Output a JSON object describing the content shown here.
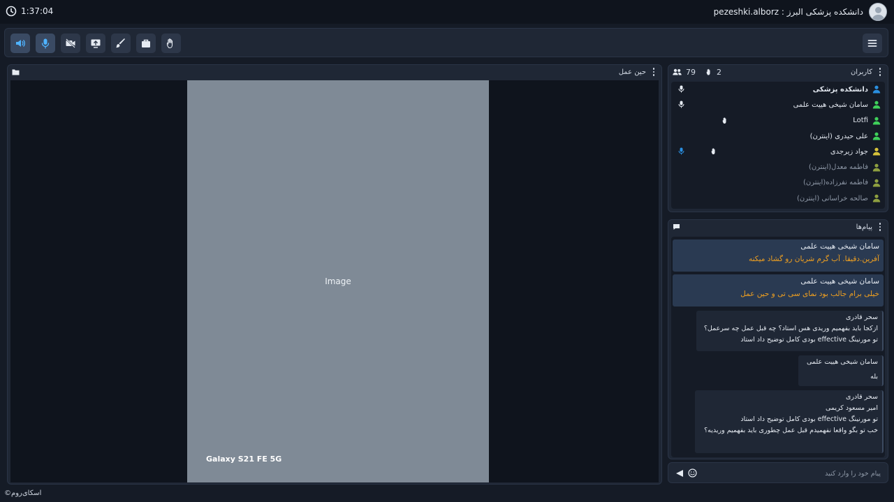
{
  "session": {
    "timer": "1:37:04"
  },
  "user": {
    "display": "pezeshki.alborz : دانشکده پزشکی البرز"
  },
  "video_panel": {
    "title": "حین عمل"
  },
  "media": {
    "watermark": "Galaxy S21 FE 5G"
  },
  "users_panel": {
    "title": "کاربران",
    "raised_hands": "2",
    "participant_count": "79",
    "items": [
      {
        "name": "دانشکده پزشکی"
      },
      {
        "name": "سامان شیخی هییت علمی"
      },
      {
        "name": "Lotfi"
      },
      {
        "name": "علی حیدری (اینترن)"
      },
      {
        "name": "جواد زیرجدی"
      },
      {
        "name": "فاطمه معدل(اینترن)"
      },
      {
        "name": "فاطمه نفرزاده(اینترن)"
      },
      {
        "name": "صالحه خراسانی (اینترن)"
      }
    ]
  },
  "messages_panel": {
    "title": "پیام‌ها",
    "messages": [
      {
        "sender": "سامان شیخی هییت علمی",
        "text": "آفرین.دقیقا. آب گرم شریان رو گشاد میکنه"
      },
      {
        "sender": "سامان شیخی هییت علمی",
        "text": "خیلی برام جالب بود نمای سی تی و حین عمل"
      }
    ],
    "replies": [
      {
        "sender": "سحر قادری",
        "lines": [
          "ازکجا باید بفهمیم وریدی هس استاد؟ چه قبل عمل چه سرعمل؟",
          "تو مورنینگ effective بودی کامل توضیح داد استاد"
        ]
      },
      {
        "sender": "سامان شیخی هییت علمی",
        "lines": [
          "بله"
        ]
      },
      {
        "sender": "سحر قادری",
        "lines": [
          "امیر مسعود کریمی",
          "تو مورنینگ effective بودی کامل توضیح داد استاد",
          "خب تو بگو واقعا نفهمیدم قبل عمل چطوری باید بفهمیم وریدیه؟"
        ]
      }
    ]
  },
  "composer": {
    "placeholder": "پیام خود را وارد کنید"
  },
  "footer": {
    "brand": "©اسکای‌روم"
  },
  "colors": {
    "accent": "#2a8fe0",
    "warning_text": "#f0a020",
    "online_green": "#3fd05a",
    "moderator_blue": "#2a8fe0",
    "idle_olive": "#8fa040"
  }
}
